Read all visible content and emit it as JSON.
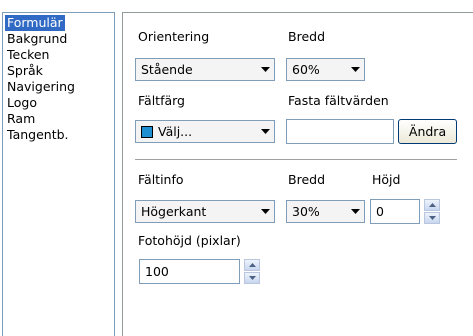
{
  "sidebar": {
    "items": [
      {
        "label": "Formulär",
        "selected": true
      },
      {
        "label": "Bakgrund",
        "selected": false
      },
      {
        "label": "Tecken",
        "selected": false
      },
      {
        "label": "Språk",
        "selected": false
      },
      {
        "label": "Navigering",
        "selected": false
      },
      {
        "label": "Logo",
        "selected": false
      },
      {
        "label": "Ram",
        "selected": false
      },
      {
        "label": "Tangentb.",
        "selected": false
      }
    ]
  },
  "form": {
    "orientation_label": "Orientering",
    "orientation_value": "Stående",
    "width_label": "Bredd",
    "width_value": "60%",
    "field_color_label": "Fältfärg",
    "field_color_value": "Välj...",
    "field_color_swatch": "#1e8fd0",
    "fixed_values_label": "Fasta fältvärden",
    "fixed_values_value": "",
    "change_button": "Ändra"
  },
  "fieldinfo": {
    "label": "Fältinfo",
    "value": "Högerkant",
    "width_label": "Bredd",
    "width_value": "30%",
    "height_label": "Höjd",
    "height_value": "0",
    "photo_height_label": "Fotohöjd (pixlar)",
    "photo_height_value": "100"
  },
  "colors": {
    "selection": "#316ac5",
    "border": "#7f9db9"
  },
  "icons": {
    "dropdown_arrow": "chevron-down-icon",
    "spin_up": "spin-up-icon",
    "spin_down": "spin-down-icon"
  }
}
